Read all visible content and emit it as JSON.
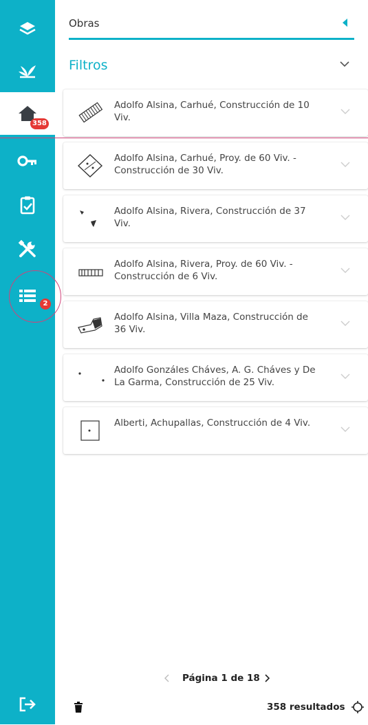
{
  "header": {
    "title": "Obras"
  },
  "filters": {
    "label": "Filtros"
  },
  "sidebar": {
    "items": [
      {
        "icon": "layers-icon"
      },
      {
        "icon": "plant-icon"
      },
      {
        "icon": "home-icon",
        "badge": "358",
        "active": true
      },
      {
        "icon": "key-icon"
      },
      {
        "icon": "clipboard-check-icon"
      },
      {
        "icon": "tools-icon"
      },
      {
        "icon": "list-icon",
        "badge": "2"
      },
      {
        "icon": "logout-icon"
      }
    ]
  },
  "obras": [
    {
      "title": "Adolfo Alsina, Carhué, Construcción de 10 Viv."
    },
    {
      "title": "Adolfo Alsina, Carhué, Proy. de 60 Viv. - Construcción de 30 Viv."
    },
    {
      "title": "Adolfo Alsina, Rivera, Construcción de 37 Viv."
    },
    {
      "title": "Adolfo Alsina, Rivera, Proy. de 60 Viv. - Construcción de 6 Viv."
    },
    {
      "title": "Adolfo Alsina, Villa Maza, Construcción de 36 Viv."
    },
    {
      "title": "Adolfo Gonzáles Cháves, A. G. Cháves y De La Garma, Construcción de 25 Viv."
    },
    {
      "title": "Alberti, Achupallas, Construcción de 4 Viv."
    }
  ],
  "pagination": {
    "label": "Página 1 de 18"
  },
  "footer": {
    "results": "358 resultados"
  },
  "colors": {
    "accent": "#0db1c8",
    "badge": "#e53935",
    "highlight": "#d0447a"
  }
}
